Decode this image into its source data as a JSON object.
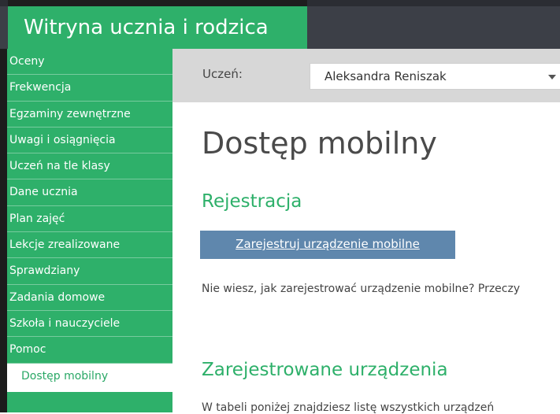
{
  "header": {
    "title": "Witryna ucznia i rodzica"
  },
  "sidebar": {
    "items": [
      {
        "label": "Oceny"
      },
      {
        "label": "Frekwencja"
      },
      {
        "label": "Egzaminy zewnętrzne"
      },
      {
        "label": "Uwagi i osiągnięcia"
      },
      {
        "label": "Uczeń na tle klasy"
      },
      {
        "label": "Dane ucznia"
      },
      {
        "label": "Plan zajęć"
      },
      {
        "label": "Lekcje zrealizowane"
      },
      {
        "label": "Sprawdziany"
      },
      {
        "label": "Zadania domowe"
      },
      {
        "label": "Szkoła i nauczyciele"
      },
      {
        "label": "Pomoc"
      },
      {
        "label": "Dostęp mobilny"
      }
    ]
  },
  "student": {
    "label": "Uczeń:",
    "selected": "Aleksandra Reniszak"
  },
  "main": {
    "title": "Dostęp mobilny",
    "registration_heading": "Rejestracja",
    "register_button": "Zarejestruj urządzenie mobilne",
    "info_text": "Nie wiesz, jak zarejestrować urządzenie mobilne? Przeczy",
    "devices_heading": "Zarejestrowane urządzenia",
    "devices_text": "W tabeli poniżej znajdziesz listę wszystkich urządzeń"
  },
  "colors": {
    "accent": "#2eb06a",
    "button": "#5f87ad",
    "header_dark": "#3c3f47"
  }
}
